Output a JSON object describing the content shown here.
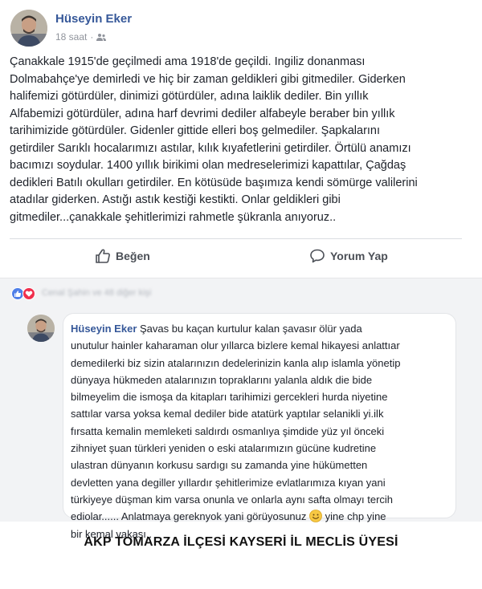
{
  "post": {
    "author": "Hüseyin Eker",
    "time": "18 saat",
    "separator": "·",
    "audience_icon": "friends-icon",
    "text_lines": [
      "Çanakkale 1915'de geçilmedi ama 1918'de geçildi. Ingiliz donanması",
      "Dolmabahçe'ye demirledi ve hiç bir zaman geldikleri gibi gitmediler. Giderken",
      "halifemizi götürdüler, dinimizi götürdüler, adına laiklik dediler. Bin yıllık",
      "Alfabemizi götürdüler, adına harf devrimi dediler alfabeyle beraber bin yıllık",
      "tarihimizide götürdüler. Gidenler gittide elleri boş gelmediler. Şapkalarını",
      "getirdiler Sarıklı hocalarımızı astılar, kılık kıyafetlerini getirdiler. Örtülü anamızı",
      "bacımızı soydular. 1400 yıllık birikimi olan medreselerimizi kapattılar, Çağdaş",
      "dedikleri Batılı okulları getirdiler. En kötüsüde başımıza kendi sömürge valilerini",
      "atadılar giderken. Astığı astık kestiği kestikti. Onlar geldikleri gibi",
      "gitmediler...çanakkale şehitlerimizi rahmetle şükranla anıyoruz.."
    ]
  },
  "actions": {
    "like_label": "Beğen",
    "comment_label": "Yorum Yap"
  },
  "reactions": {
    "names_blurred": "Cenal Şahin ve 48 diğer kişi"
  },
  "comment": {
    "author": "Hüseyin Eker",
    "first_line_rest": " Şavas bu kaçan kurtulur kalan şavasır ölür yada",
    "lines": [
      "unutulur hainler kaharaman olur yıllarca bizlere kemal hikayesi anlattıar",
      "demediIerki biz sizin atalarınızın dedelerinizin kanla alıp islamla yönetip",
      "dünyaya hükmeden atalarınızın topraklarını yalanla aldık die bide",
      "bilmeyelim die ismoşa da kitapları tarihimizi gercekleri hurda niyetine",
      "sattılar varsa yoksa kemal dediler bide atatürk yaptılar selanikli yi.ilk",
      "fırsatta kemalin memleketi saldırdı osmanlıya şimdide yüz yıl önceki",
      "zihniyet şuan türkleri yeniden o eski atalarımızın gücüne kudretine",
      "ulastran dünyanın korkusu sardıgı su zamanda yine hükümetten",
      "devletten yana degiller yıllardır şehitlerimize evlatlarımıza kıyan yani",
      "türkiyeye düşman kim varsa onunla ve onlarla aynı safta olmayı tercih"
    ],
    "line_before_emoji": "ediolar...... Anlatmaya gereknyok yani görüyosunuz",
    "line_after_emoji": " yine chp yine",
    "last_line": "bir kemal vakası..",
    "emoji_icon": "smiley-emoji-icon"
  },
  "caption": "AKP TOMARZA İLÇESİ KAYSERİ İL MECLİS ÜYESİ",
  "colors": {
    "link_blue": "#365899",
    "text": "#1d2129",
    "muted": "#90949c",
    "comment_bg": "#f2f3f5",
    "like_reaction": "#4f7fe8",
    "love_reaction": "#f0304d"
  }
}
